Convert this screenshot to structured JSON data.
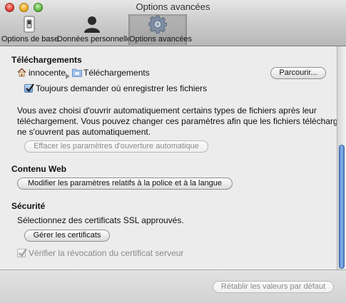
{
  "window": {
    "title": "Options avancées"
  },
  "toolbar": {
    "tabs": [
      {
        "label": "Options de base",
        "icon": "switch-icon",
        "selected": false
      },
      {
        "label": "Données personnelles",
        "icon": "person-icon",
        "selected": false
      },
      {
        "label": "Options avancées",
        "icon": "gear-icon",
        "selected": true
      }
    ]
  },
  "downloads": {
    "title": "Téléchargements",
    "path_home": "innocente",
    "path_folder": "Téléchargements",
    "browse_button": "Parcourir...",
    "always_ask_label": "Toujours demander où enregistrer les fichiers",
    "always_ask_checked": true,
    "description_lines": [
      "Vous avez choisi d'ouvrir automatiquement certains types de fichiers après leur",
      "téléchargement. Vous pouvez changer ces paramètres afin que les fichiers téléchargés",
      "ne s'ouvrent pas automatiquement."
    ],
    "clear_auto_open_button": "Effacer les paramètres d'ouverture automatique"
  },
  "web_content": {
    "title": "Contenu Web",
    "font_language_button": "Modifier les paramètres relatifs à la police et à la langue"
  },
  "security": {
    "title": "Sécurité",
    "ssl_text": "Sélectionnez des certificats SSL approuvés.",
    "manage_certificates_button": "Gérer les certificats",
    "check_revocation_label": "Vérifier la révocation du certificat serveur",
    "check_revocation_checked": true
  },
  "footer": {
    "restore_defaults_button": "Rétablir les valeurs par défaut"
  },
  "colors": {
    "accent": "#4f7ec8",
    "window_background": "#ececec",
    "disabled_text": "#8a8a8a"
  }
}
